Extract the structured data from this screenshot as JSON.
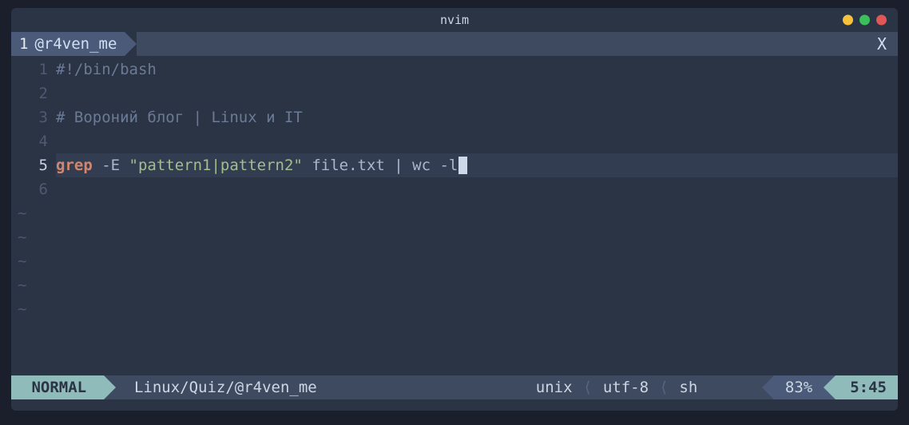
{
  "window": {
    "title": "nvim"
  },
  "tabline": {
    "tabs": [
      {
        "index": "1",
        "label": "@r4ven_me"
      }
    ],
    "close_label": "X"
  },
  "editor": {
    "lines": [
      {
        "n": "1",
        "tokens": [
          {
            "c": "tok-comment",
            "t": "#!/bin/bash"
          }
        ]
      },
      {
        "n": "2",
        "tokens": []
      },
      {
        "n": "3",
        "tokens": [
          {
            "c": "tok-comment",
            "t": "# Вороний блог | Linux и IT"
          }
        ]
      },
      {
        "n": "4",
        "tokens": []
      },
      {
        "n": "5",
        "current": true,
        "tokens": [
          {
            "c": "tok-cmd",
            "t": "grep"
          },
          {
            "c": "tok-plain",
            "t": " -E "
          },
          {
            "c": "tok-str",
            "t": "\"pattern1|pattern2\""
          },
          {
            "c": "tok-plain",
            "t": " file.txt | wc -l"
          }
        ],
        "cursor_after": true
      },
      {
        "n": "6",
        "tokens": []
      }
    ],
    "tilde_rows": 5
  },
  "status": {
    "mode": " NORMAL ",
    "path": "Linux/Quiz/@r4ven_me",
    "fileformat": "unix",
    "encoding": "utf-8",
    "filetype": "sh",
    "percent": "83%",
    "position": "5:45"
  }
}
